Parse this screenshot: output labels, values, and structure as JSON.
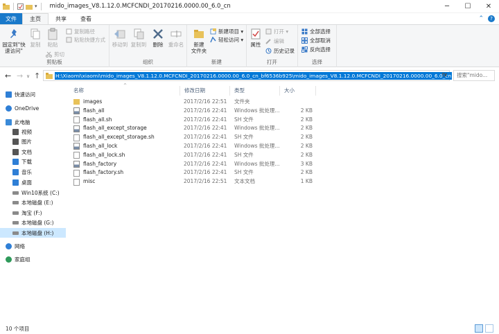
{
  "window": {
    "title": "mido_images_V8.1.12.0.MCFCNDI_20170216.0000.00_6.0_cn",
    "minimize": "─",
    "maximize": "☐",
    "close": "✕"
  },
  "tabs": {
    "file": "文件",
    "home": "主页",
    "share": "共享",
    "view": "查看"
  },
  "ribbon": {
    "clipboard": {
      "label": "剪贴板",
      "pin": "固定到\"快\n速访问\"",
      "copy": "复制",
      "paste": "粘贴",
      "copy_path": "复制路径",
      "paste_shortcut": "粘贴快捷方式",
      "cut": "剪切"
    },
    "organize": {
      "label": "组织",
      "move_to": "移动到",
      "copy_to": "复制到",
      "delete": "删除",
      "rename": "重命名"
    },
    "new": {
      "label": "新建",
      "new_folder": "新建\n文件夹",
      "new_item": "新建项目 ▾",
      "easy_access": "轻松访问 ▾"
    },
    "open": {
      "label": "打开",
      "properties": "属性",
      "open": "打开 ▾",
      "edit": "编辑",
      "history": "历史记录"
    },
    "select": {
      "label": "选择",
      "select_all": "全部选择",
      "select_none": "全部取消",
      "invert": "反向选择"
    }
  },
  "address": {
    "path": "H:\\Xiaomi\\xiaomi\\mido_images_V8.1.12.0.MCFCNDI_20170216.0000.00_6.0_cn_bf6536b925\\mido_images_V8.1.12.0.MCFCNDI_20170216.0000.00_6.0_cn",
    "search_placeholder": "搜索\"mido...",
    "back": "←",
    "forward": "→",
    "up": "↑",
    "recent": "∨",
    "dropdown": "∨",
    "refresh": "↻"
  },
  "nav": [
    {
      "label": "快速访问",
      "icon": "star-icon",
      "color": "#2f7fd6"
    },
    {
      "label": "OneDrive",
      "icon": "cloud-icon",
      "color": "#2f7fd6"
    },
    {
      "label": "此电脑",
      "icon": "computer-icon",
      "color": "#3a8ad8"
    },
    {
      "label": "视频",
      "icon": "video-folder-icon",
      "color": "#555"
    },
    {
      "label": "图片",
      "icon": "pictures-folder-icon",
      "color": "#555"
    },
    {
      "label": "文档",
      "icon": "documents-folder-icon",
      "color": "#555"
    },
    {
      "label": "下载",
      "icon": "download-folder-icon",
      "color": "#2f7fd6"
    },
    {
      "label": "音乐",
      "icon": "music-folder-icon",
      "color": "#2f7fd6"
    },
    {
      "label": "桌面",
      "icon": "desktop-folder-icon",
      "color": "#2f7fd6"
    },
    {
      "label": "Win10系统 (C:)",
      "icon": "system-drive-icon",
      "color": "#666"
    },
    {
      "label": "本地磁盘 (E:)",
      "icon": "drive-icon",
      "color": "#666"
    },
    {
      "label": "淘宝 (F:)",
      "icon": "drive-icon",
      "color": "#666"
    },
    {
      "label": "本地磁盘 (G:)",
      "icon": "drive-icon",
      "color": "#666"
    },
    {
      "label": "本地磁盘 (H:)",
      "icon": "drive-icon",
      "color": "#666"
    },
    {
      "label": "网络",
      "icon": "network-icon",
      "color": "#2f7fd6"
    },
    {
      "label": "家庭组",
      "icon": "homegroup-icon",
      "color": "#2f9a5a"
    }
  ],
  "columns": {
    "name": "名称",
    "date": "修改日期",
    "type": "类型",
    "size": "大小"
  },
  "files": [
    {
      "name": "images",
      "date": "2017/2/16 22:51",
      "type": "文件夹",
      "size": "",
      "kind": "folder"
    },
    {
      "name": "flash_all",
      "date": "2017/2/16 22:41",
      "type": "Windows 批处理...",
      "size": "2 KB",
      "kind": "bat"
    },
    {
      "name": "flash_all.sh",
      "date": "2017/2/16 22:41",
      "type": "SH 文件",
      "size": "2 KB",
      "kind": "file"
    },
    {
      "name": "flash_all_except_storage",
      "date": "2017/2/16 22:41",
      "type": "Windows 批处理...",
      "size": "2 KB",
      "kind": "bat"
    },
    {
      "name": "flash_all_except_storage.sh",
      "date": "2017/2/16 22:41",
      "type": "SH 文件",
      "size": "2 KB",
      "kind": "file"
    },
    {
      "name": "flash_all_lock",
      "date": "2017/2/16 22:41",
      "type": "Windows 批处理...",
      "size": "2 KB",
      "kind": "bat"
    },
    {
      "name": "flash_all_lock.sh",
      "date": "2017/2/16 22:41",
      "type": "SH 文件",
      "size": "2 KB",
      "kind": "file"
    },
    {
      "name": "flash_factory",
      "date": "2017/2/16 22:41",
      "type": "Windows 批处理...",
      "size": "3 KB",
      "kind": "bat"
    },
    {
      "name": "flash_factory.sh",
      "date": "2017/2/16 22:41",
      "type": "SH 文件",
      "size": "2 KB",
      "kind": "file"
    },
    {
      "name": "misc",
      "date": "2017/2/16 22:51",
      "type": "文本文档",
      "size": "1 KB",
      "kind": "file"
    }
  ],
  "status": {
    "count": "10 个项目"
  },
  "colors": {
    "accent": "#1979ca",
    "selection": "#0078d7",
    "nav_selected": "#cce8ff",
    "folder": "#e8c25a"
  }
}
